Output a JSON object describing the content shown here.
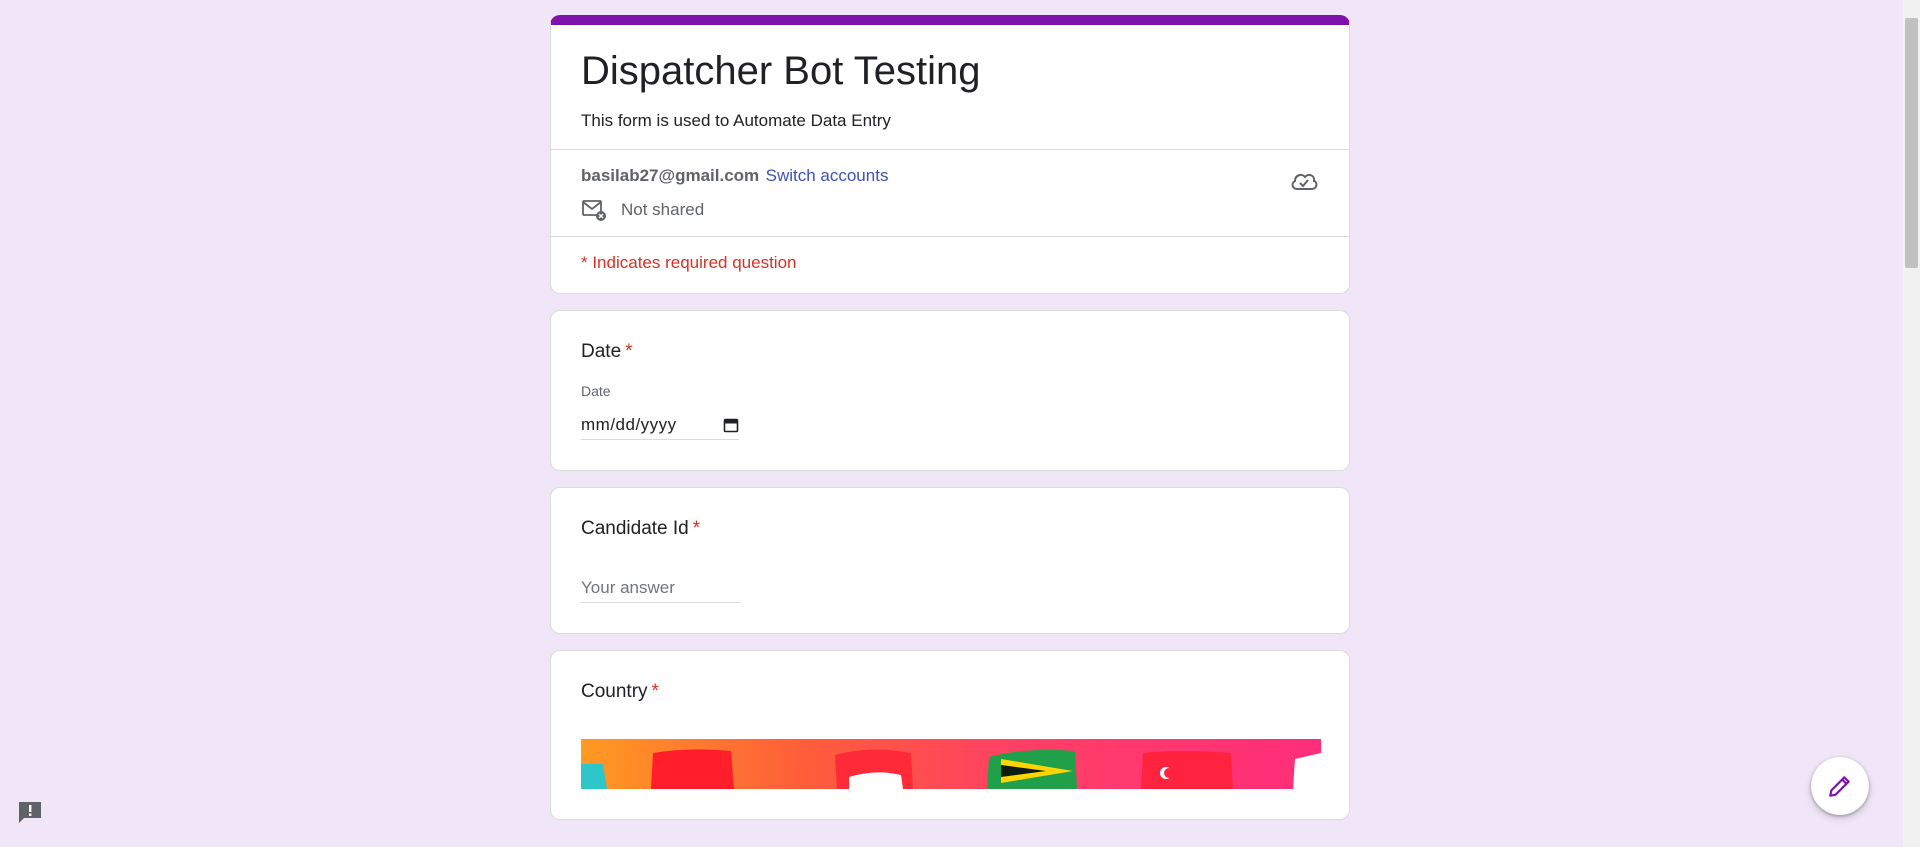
{
  "form": {
    "title": "Dispatcher Bot Testing",
    "description": "This form is used to Automate Data Entry",
    "accent_color": "#7e10ab",
    "background_color": "#f0e6f7"
  },
  "account": {
    "email": "basilab27@gmail.com",
    "switch_label": "Switch accounts",
    "share_status": "Not shared"
  },
  "required_note": "* Indicates required question",
  "questions": {
    "date": {
      "title": "Date",
      "star": "*",
      "sub_label": "Date",
      "placeholder": "mm/dd/yyyy"
    },
    "candidate": {
      "title": "Candidate Id",
      "star": "*",
      "placeholder": "Your answer"
    },
    "country": {
      "title": "Country",
      "star": "*"
    }
  },
  "icons": {
    "share": "mail-icon",
    "cloud": "cloud-check-icon",
    "calendar": "calendar-icon",
    "feedback": "feedback-icon",
    "edit": "pencil-icon"
  }
}
